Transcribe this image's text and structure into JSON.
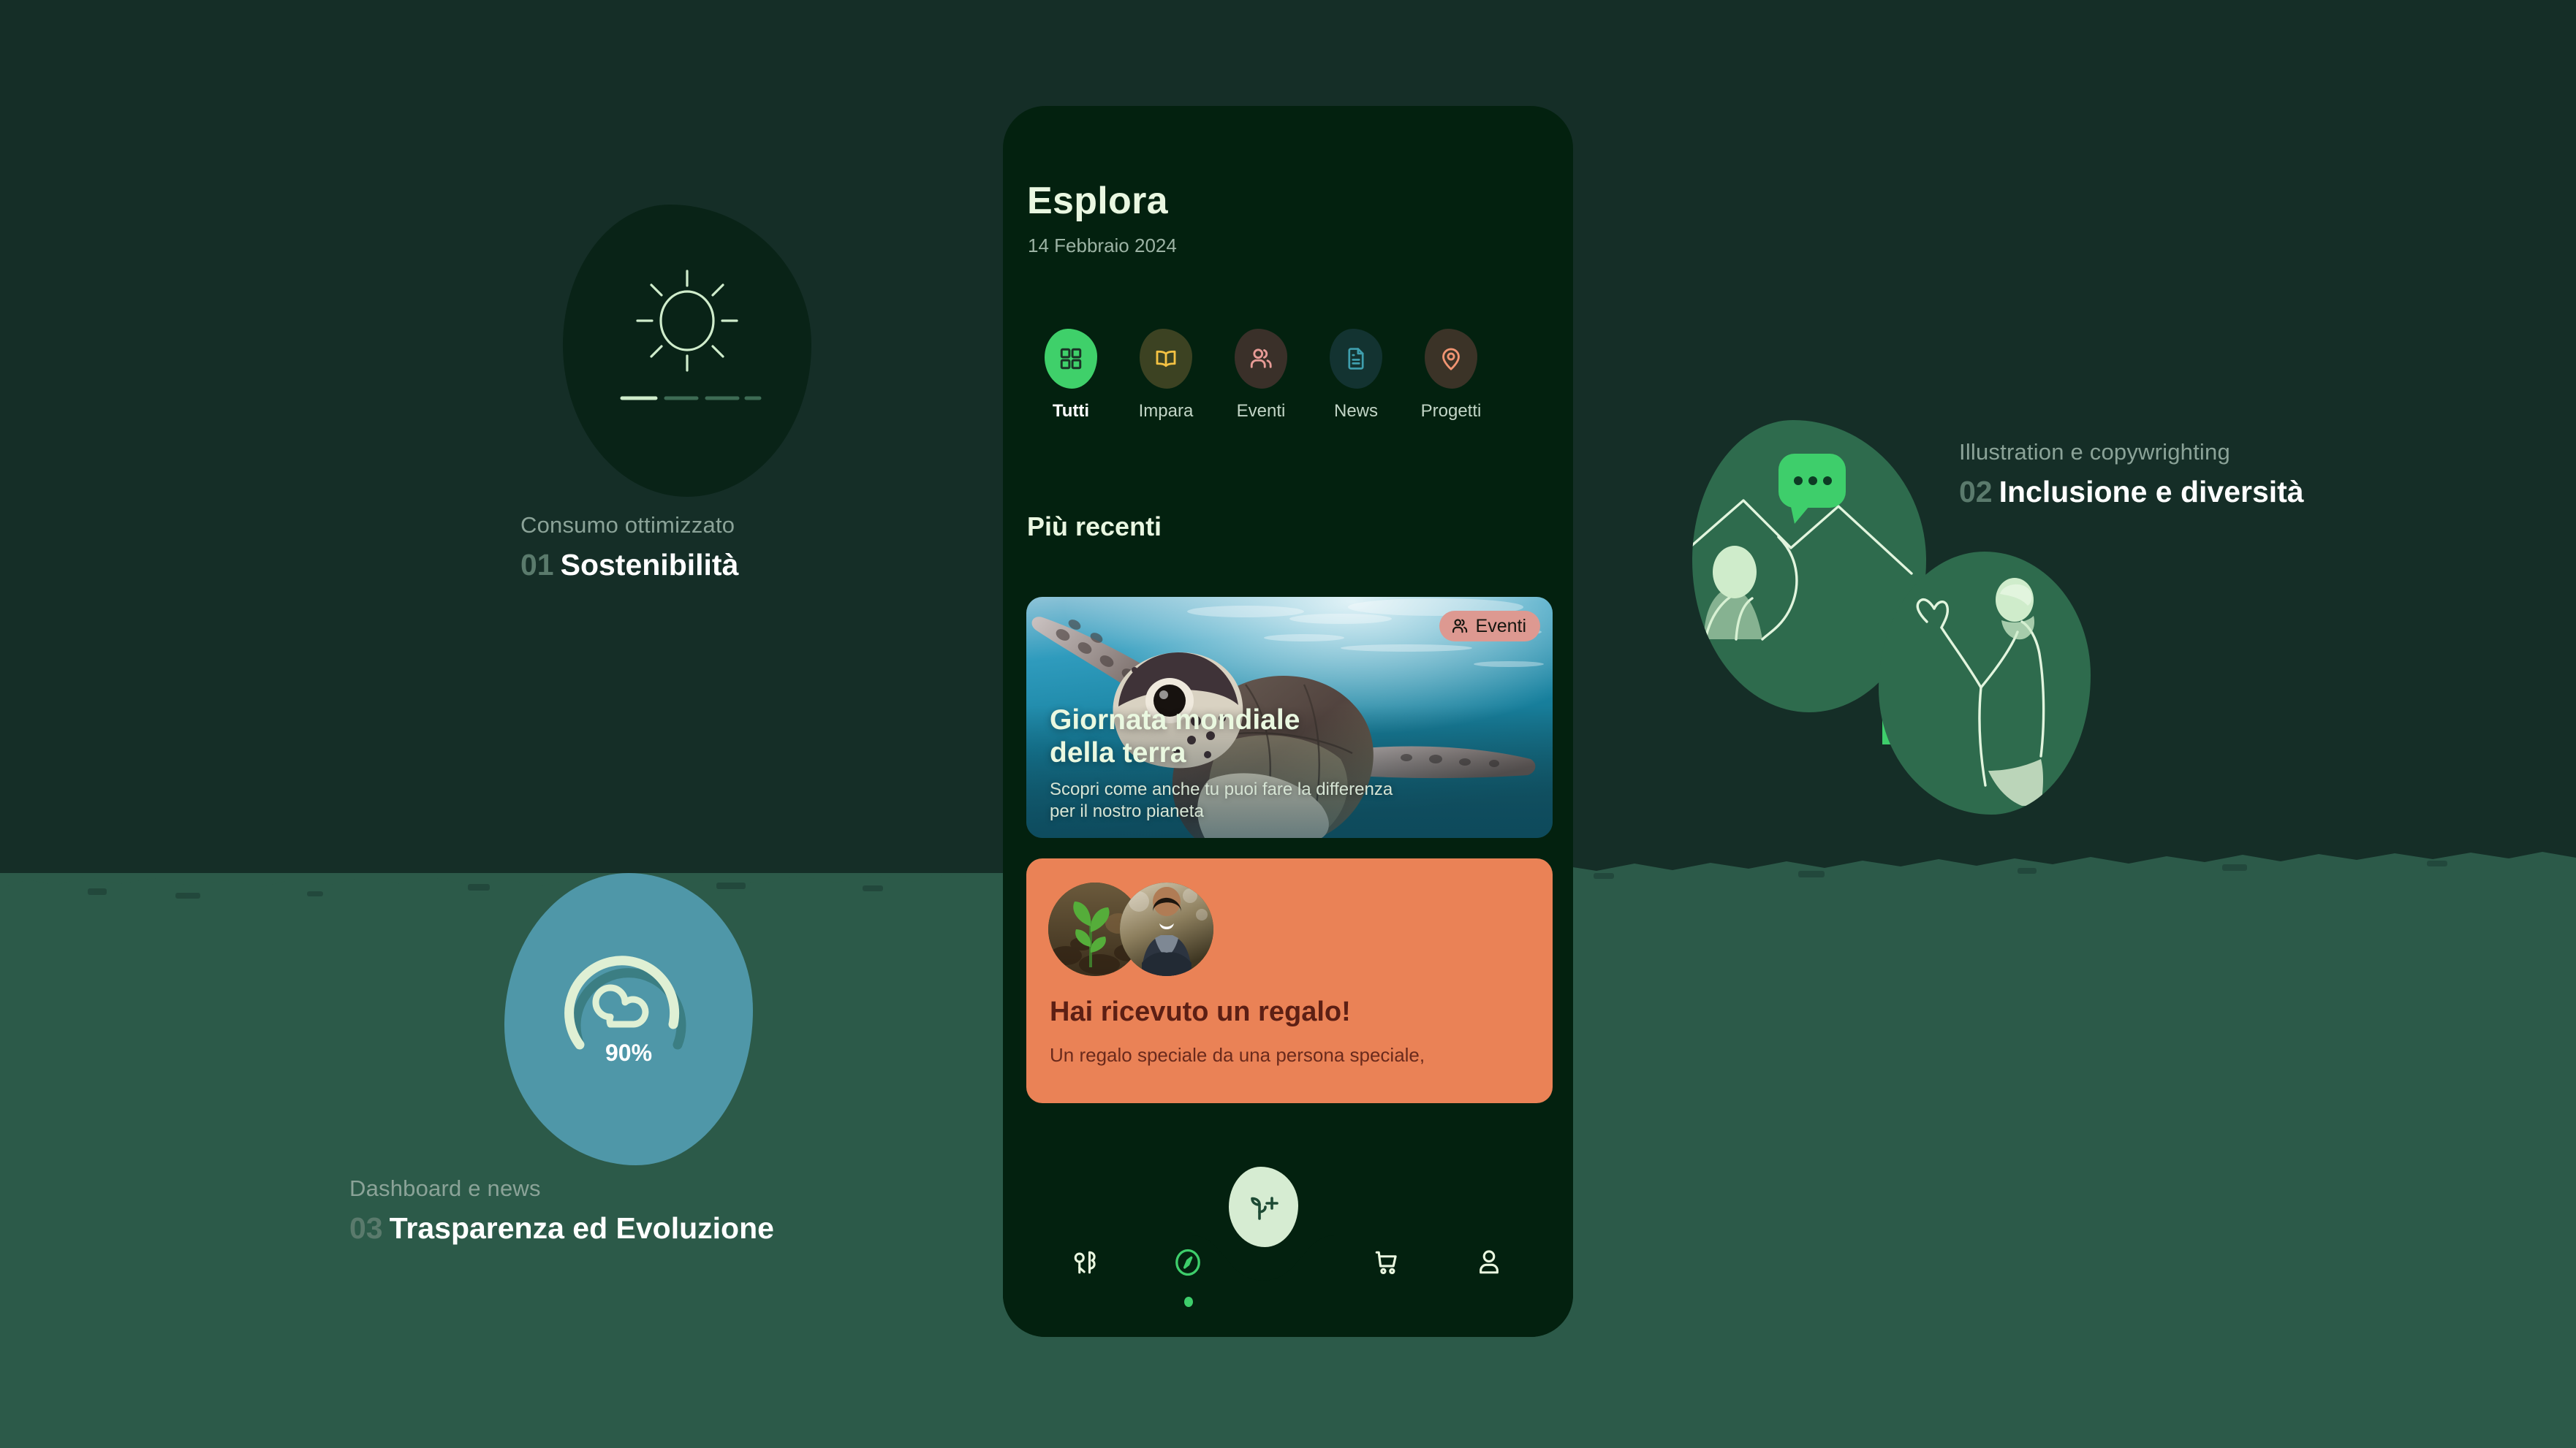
{
  "background": {
    "top_color": "#152e27",
    "bottom_color": "#2c5a49"
  },
  "annotations": [
    {
      "id": "sostenibilita",
      "subtitle": "Consumo ottimizzato",
      "number": "01",
      "title": "Sostenibilità",
      "illustration": "sun-icon",
      "blob_color": "#092317"
    },
    {
      "id": "inclusione",
      "subtitle": "Illustration e copywrighting",
      "number": "02",
      "title": "Inclusione e diversità",
      "illustration": "people-chat-illustration",
      "blob_color": "#2e6b4d",
      "accent_color": "#3ece6b"
    },
    {
      "id": "trasparenza",
      "subtitle": "Dashboard e news",
      "number": "03",
      "title": "Trasparenza ed Evoluzione",
      "illustration": "cloud-gauge-icon",
      "blob_color": "#4f97a8",
      "gauge_value": "90%",
      "gauge_percent": 90
    }
  ],
  "phone": {
    "screen_bg": "#03210f",
    "header": {
      "title": "Esplora",
      "date": "14 Febbraio 2024"
    },
    "chips": [
      {
        "label": "Tutti",
        "icon": "grid-icon",
        "bg": "#3fd06a",
        "fg": "#1a3326",
        "active": true
      },
      {
        "label": "Impara",
        "icon": "book-icon",
        "bg": "#3c4222",
        "fg": "#f5c243",
        "active": false
      },
      {
        "label": "Eventi",
        "icon": "people-icon",
        "bg": "#3a3029",
        "fg": "#e79b96",
        "active": false
      },
      {
        "label": "News",
        "icon": "document-icon",
        "bg": "#133331",
        "fg": "#3f9fae",
        "active": false
      },
      {
        "label": "Progetti",
        "icon": "location-icon",
        "bg": "#3b3327",
        "fg": "#f09472",
        "active": false
      }
    ],
    "section_title": "Più recenti",
    "cards": [
      {
        "id": "card-turtle",
        "badge": "Eventi",
        "badge_icon": "people-icon",
        "badge_bg": "#dd9991",
        "title": "Giornata mondiale della terra",
        "title_line1": "Giornata mondiale",
        "title_line2": "della terra",
        "subtitle_line1": "Scopri come anche tu puoi fare la differenza",
        "subtitle_line2": "per il nostro pianeta",
        "image": "sea-turtle-photo"
      },
      {
        "id": "card-gift",
        "bg": "#ea8256",
        "title": "Hai ricevuto un regalo!",
        "subtitle": "Un regalo speciale da una persona speciale,",
        "avatars": [
          "seedling-photo",
          "smiling-man-photo"
        ]
      }
    ],
    "nav": {
      "items": [
        {
          "label": "Ambiente",
          "icon": "trees-icon",
          "active": false
        },
        {
          "label": "Esplora",
          "icon": "compass-icon",
          "active": true
        },
        {
          "label": "Carrello",
          "icon": "cart-icon",
          "active": false
        },
        {
          "label": "Profilo",
          "icon": "person-icon",
          "active": false
        }
      ],
      "fab": {
        "icon": "plant-plus-icon",
        "bg": "#d6ecd2",
        "fg": "#1d4a34"
      },
      "active_color": "#3ece6b"
    }
  }
}
